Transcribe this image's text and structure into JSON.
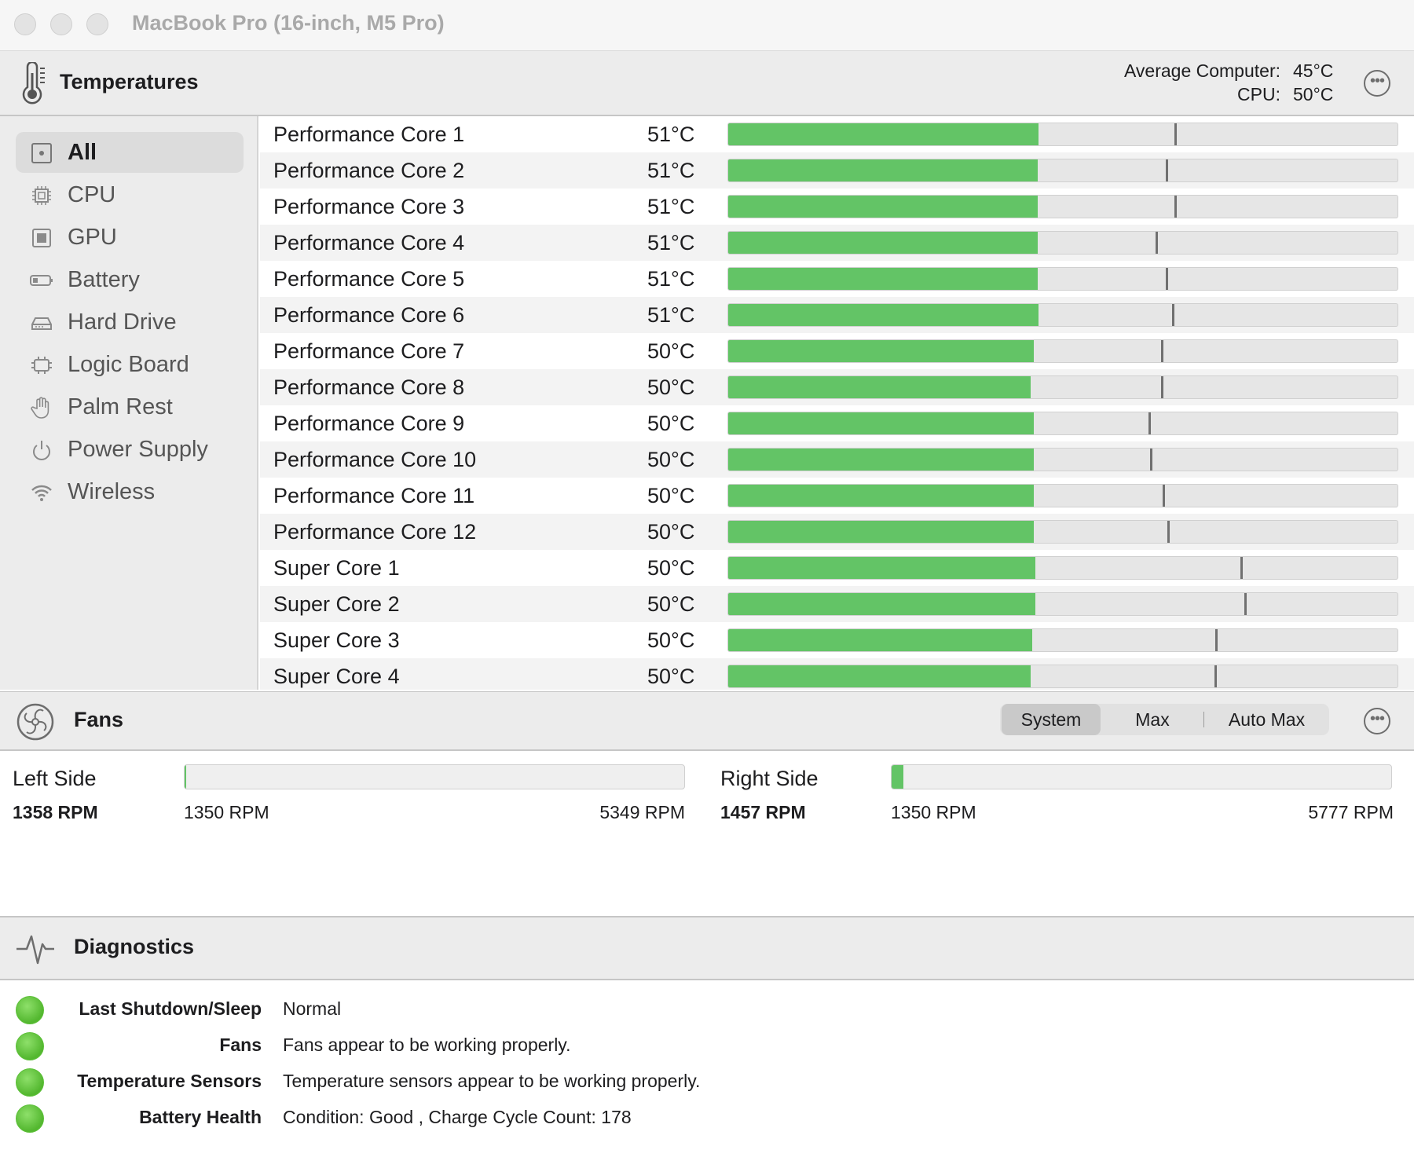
{
  "window": {
    "title": "MacBook Pro (16-inch, M5 Pro)"
  },
  "temperatures": {
    "title": "Temperatures",
    "average_label": "Average Computer:",
    "average_value": "45°C",
    "cpu_label": "CPU:",
    "cpu_value": "50°C",
    "icon": "thermometer-icon",
    "more_icon": "ellipsis-icon"
  },
  "sidebar": {
    "items": [
      {
        "label": "All",
        "icon": "all-sensors-icon",
        "selected": true
      },
      {
        "label": "CPU",
        "icon": "cpu-chip-icon",
        "selected": false
      },
      {
        "label": "GPU",
        "icon": "gpu-chip-icon",
        "selected": false
      },
      {
        "label": "Battery",
        "icon": "battery-icon",
        "selected": false
      },
      {
        "label": "Hard Drive",
        "icon": "hard-drive-icon",
        "selected": false
      },
      {
        "label": "Logic Board",
        "icon": "logic-board-icon",
        "selected": false
      },
      {
        "label": "Palm Rest",
        "icon": "hand-icon",
        "selected": false
      },
      {
        "label": "Power Supply",
        "icon": "power-icon",
        "selected": false
      },
      {
        "label": "Wireless",
        "icon": "wifi-icon",
        "selected": false
      }
    ]
  },
  "sensors": [
    {
      "name": "Performance Core 1",
      "value": "51°C",
      "fill": 0.464,
      "max": 0.667
    },
    {
      "name": "Performance Core 2",
      "value": "51°C",
      "fill": 0.462,
      "max": 0.654
    },
    {
      "name": "Performance Core 3",
      "value": "51°C",
      "fill": 0.462,
      "max": 0.667
    },
    {
      "name": "Performance Core 4",
      "value": "51°C",
      "fill": 0.462,
      "max": 0.639
    },
    {
      "name": "Performance Core 5",
      "value": "51°C",
      "fill": 0.462,
      "max": 0.654
    },
    {
      "name": "Performance Core 6",
      "value": "51°C",
      "fill": 0.464,
      "max": 0.663
    },
    {
      "name": "Performance Core 7",
      "value": "50°C",
      "fill": 0.457,
      "max": 0.647
    },
    {
      "name": "Performance Core 8",
      "value": "50°C",
      "fill": 0.452,
      "max": 0.647
    },
    {
      "name": "Performance Core 9",
      "value": "50°C",
      "fill": 0.457,
      "max": 0.628
    },
    {
      "name": "Performance Core 10",
      "value": "50°C",
      "fill": 0.457,
      "max": 0.63
    },
    {
      "name": "Performance Core 11",
      "value": "50°C",
      "fill": 0.457,
      "max": 0.649
    },
    {
      "name": "Performance Core 12",
      "value": "50°C",
      "fill": 0.457,
      "max": 0.656
    },
    {
      "name": "Super Core 1",
      "value": "50°C",
      "fill": 0.459,
      "max": 0.765
    },
    {
      "name": "Super Core 2",
      "value": "50°C",
      "fill": 0.459,
      "max": 0.771
    },
    {
      "name": "Super Core 3",
      "value": "50°C",
      "fill": 0.454,
      "max": 0.728
    },
    {
      "name": "Super Core 4",
      "value": "50°C",
      "fill": 0.452,
      "max": 0.726
    }
  ],
  "fans": {
    "title": "Fans",
    "icon": "fan-icon",
    "more_icon": "ellipsis-icon",
    "modes": [
      {
        "label": "System",
        "active": true
      },
      {
        "label": "Max",
        "active": false
      },
      {
        "label": "Auto Max",
        "active": false
      }
    ],
    "left": {
      "name": "Left Side",
      "rpm": "1358 RPM",
      "min": "1350 RPM",
      "max": "5349 RPM",
      "fraction": 0.002
    },
    "right": {
      "name": "Right Side",
      "rpm": "1457 RPM",
      "min": "1350 RPM",
      "max": "5777 RPM",
      "fraction": 0.024
    }
  },
  "diagnostics": {
    "title": "Diagnostics",
    "icon": "pulse-icon",
    "items": [
      {
        "label": "Last Shutdown/Sleep",
        "value": "Normal",
        "status_color": "#5cc038"
      },
      {
        "label": "Fans",
        "value": "Fans appear to be working properly.",
        "status_color": "#5cc038"
      },
      {
        "label": "Temperature Sensors",
        "value": "Temperature sensors appear to be working properly.",
        "status_color": "#5cc038"
      },
      {
        "label": "Battery Health",
        "value": "Condition: Good , Charge Cycle Count: 178",
        "status_color": "#5cc038"
      }
    ]
  },
  "colors": {
    "accent_green": "#63c466",
    "track": "#e6e6e6",
    "max_marker": "#707070"
  }
}
